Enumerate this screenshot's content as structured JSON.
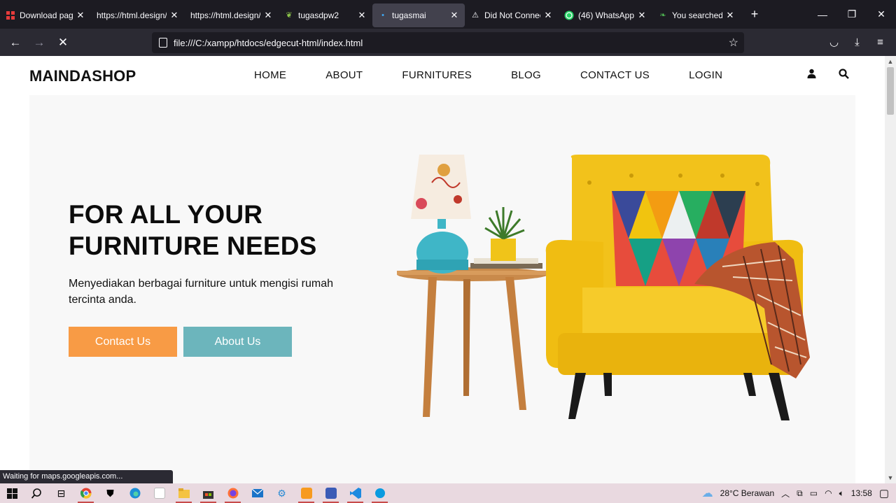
{
  "browser": {
    "tabs": [
      {
        "title": "Download page",
        "favicon": "app-grid-icon",
        "active": false
      },
      {
        "title": "https://html.design/",
        "favicon": "",
        "active": false
      },
      {
        "title": "https://html.design/",
        "favicon": "",
        "active": false
      },
      {
        "title": "tugasdpw2",
        "favicon": "sprout-icon",
        "active": false
      },
      {
        "title": "tugasmai",
        "favicon": "loading-dot-icon",
        "active": true
      },
      {
        "title": "Did Not Connect",
        "favicon": "warning-icon",
        "active": false
      },
      {
        "title": "(46) WhatsApp",
        "favicon": "whatsapp-icon",
        "active": false
      },
      {
        "title": "You searched for",
        "favicon": "leaf-icon",
        "active": false
      }
    ],
    "url": "file:///C:/xampp/htdocs/edgecut-html/index.html",
    "status_text": "Waiting for maps.googleapis.com..."
  },
  "site": {
    "logo": "MAINDASHOP",
    "menu": [
      "HOME",
      "ABOUT",
      "FURNITURES",
      "BLOG",
      "CONTACT US",
      "LOGIN"
    ],
    "hero": {
      "title": "FOR ALL YOUR FURNITURE NEEDS",
      "text": "Menyediakan berbagai furniture untuk mengisi rumah tercinta anda.",
      "contact_button": "Contact Us",
      "about_button": "About Us"
    },
    "colors": {
      "contact_button": "#f89b45",
      "about_button": "#6cb5bc",
      "chair": "#f2c21b"
    }
  },
  "taskbar": {
    "weather": "28°C  Berawan",
    "time": "13:58"
  }
}
